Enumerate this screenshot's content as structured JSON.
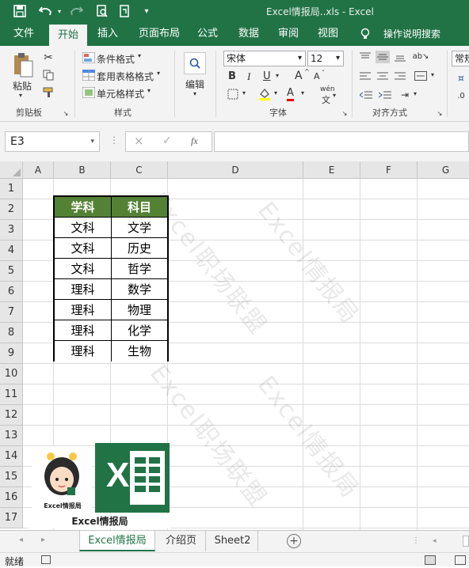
{
  "window": {
    "title": "Excel情报局..xls  -  Excel"
  },
  "quick_access": {
    "save_icon": "save-icon",
    "undo_icon": "undo-icon",
    "redo_icon": "redo-icon",
    "preview_icon": "print-preview-icon",
    "touch_icon": "touch-mode-icon",
    "customize_icon": "customize-icon"
  },
  "ribbon_tabs": [
    "文件",
    "开始",
    "插入",
    "页面布局",
    "公式",
    "数据",
    "审阅",
    "视图"
  ],
  "tell_me": "操作说明搜索",
  "clipboard": {
    "paste": "粘贴",
    "label": "剪贴板"
  },
  "styles": {
    "conditional": "条件格式",
    "table": "套用表格格式",
    "cell": "单元格样式",
    "label": "样式"
  },
  "editing": {
    "label": "编辑"
  },
  "font": {
    "name": "宋体",
    "size": "12",
    "bold": "B",
    "italic": "I",
    "underline": "U",
    "grow": "A",
    "shrink": "A",
    "color_a": "A",
    "phonetic": "wén",
    "label": "字体"
  },
  "alignment": {
    "label": "对齐方式"
  },
  "number": {
    "format": "常规"
  },
  "formula_bar": {
    "name_box": "E3",
    "fx": "fx",
    "cancel": "×",
    "enter": "✓",
    "value": ""
  },
  "columns": [
    "A",
    "B",
    "C",
    "D",
    "E",
    "F",
    "G"
  ],
  "rows": [
    "1",
    "2",
    "3",
    "4",
    "5",
    "6",
    "7",
    "8",
    "9",
    "10",
    "11",
    "12",
    "13",
    "14",
    "15",
    "16",
    "17"
  ],
  "table": {
    "headers": [
      "学科",
      "科目"
    ],
    "rows": [
      [
        "文科",
        "文学"
      ],
      [
        "文科",
        "历史"
      ],
      [
        "文科",
        "哲学"
      ],
      [
        "理科",
        "数学"
      ],
      [
        "理科",
        "物理"
      ],
      [
        "理科",
        "化学"
      ],
      [
        "理科",
        "生物"
      ]
    ]
  },
  "watermark": [
    "Excel职场联盟",
    "Excel情报局",
    "Excel职场联盟",
    "Excel情报局"
  ],
  "logo": {
    "caption_small": "Excel情报局",
    "caption": "Excel情报局",
    "excel_letter": "X"
  },
  "sheet_tabs": [
    "Excel情报局",
    "介绍页",
    "Sheet2"
  ],
  "active_sheet": "Excel情报局",
  "status": {
    "ready": "就绪"
  },
  "colors": {
    "excel_green": "#217346",
    "header_fill": "#548235"
  }
}
